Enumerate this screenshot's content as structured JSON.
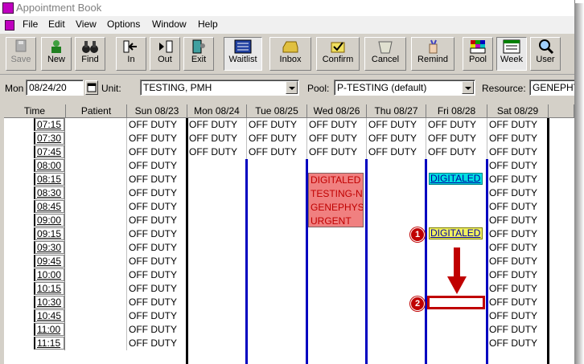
{
  "window": {
    "title": "Appointment Book"
  },
  "menu": [
    "File",
    "Edit",
    "View",
    "Options",
    "Window",
    "Help"
  ],
  "toolbar": {
    "save": "Save",
    "new": "New",
    "find": "Find",
    "in": "In",
    "out": "Out",
    "exit": "Exit",
    "waitlist": "Waitlist",
    "inbox": "Inbox",
    "confirm": "Confirm",
    "cancel": "Cancel",
    "remind": "Remind",
    "pool": "Pool",
    "week": "Week",
    "user": "User"
  },
  "filters": {
    "day_label": "Mon",
    "date": "08/24/20",
    "unit_label": "Unit:",
    "unit": "TESTING, PMH",
    "pool_label": "Pool:",
    "pool": "P-TESTING (default)",
    "resource_label": "Resource:",
    "resource": "GENEPHYS"
  },
  "grid": {
    "headers": [
      "Time",
      "Patient",
      "Sun 08/23",
      "Mon 08/24",
      "Tue 08/25",
      "Wed 08/26",
      "Thu 08/27",
      "Fri 08/28",
      "Sat 08/29"
    ],
    "times": [
      "07:15",
      "07:30",
      "07:45",
      "08:00",
      "08:15",
      "08:30",
      "08:45",
      "09:00",
      "09:15",
      "09:30",
      "09:45",
      "10:00",
      "10:15",
      "10:30",
      "10:45",
      "11:00",
      "11:15"
    ],
    "off_duty": "OFF DUTY",
    "appointments": {
      "wed_block": [
        "DIGITALED",
        "TESTING-N",
        "GENEPHYS",
        "URGENT"
      ],
      "fri_0815": "DIGITALED",
      "fri_0915": "DIGITALED"
    },
    "colors": {
      "wed_block": "#f08080",
      "fri_0815": "#00e0e0",
      "fri_0915": "#f0f060",
      "column_divider": "#0000c0",
      "marker": "#c00000"
    }
  },
  "markers": [
    "1",
    "2"
  ]
}
